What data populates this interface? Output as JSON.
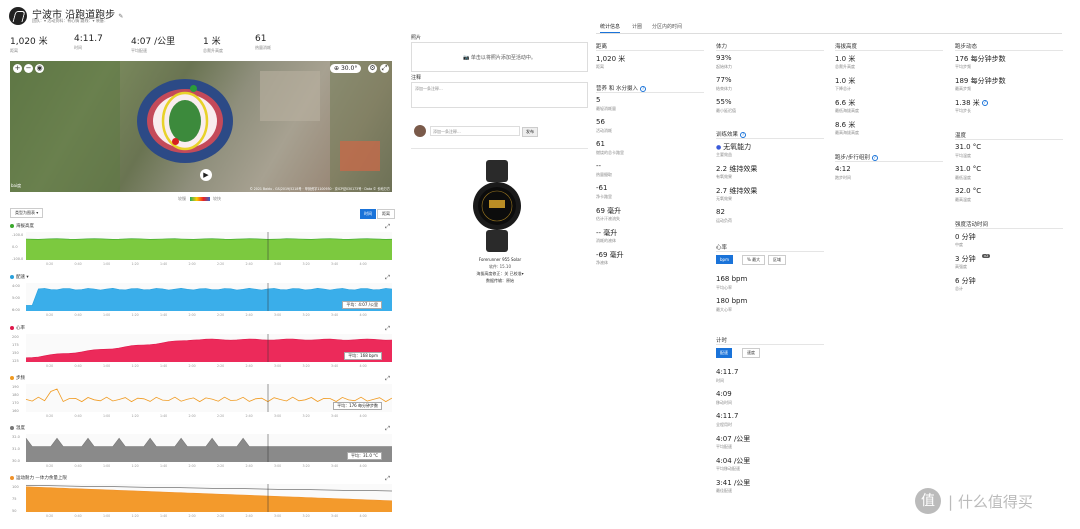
{
  "header": {
    "title": "宁波市 沿跑道跑步",
    "subline": "团队：▾   活动资料：有心情   路线：▾   装备："
  },
  "summary": [
    {
      "value": "1,020 米",
      "label": "距离"
    },
    {
      "value": "4:11.7",
      "label": "时间"
    },
    {
      "value": "4:07 /公里",
      "label": "平均配速"
    },
    {
      "value": "1 米",
      "label": "总爬升高度"
    },
    {
      "value": "61",
      "label": "热量消耗"
    }
  ],
  "map": {
    "zoom_label": "30.0°",
    "credits": "© 2021 Baidu - GS(2019)5218号 · 甲测资字1100930 · 京ICP证030173号 · Data © 长地万方",
    "legend_left": "较慢",
    "legend_right": "较快"
  },
  "charts_toolbar": {
    "select": "类型为图表 ▾",
    "btn_time": "时间",
    "btn_distance": "距离"
  },
  "charts": [
    {
      "key": "elev",
      "title": "海拔高度",
      "color": "#39a82c",
      "fill": "#7cc93f",
      "ticks": [
        "-100.0",
        "0.0",
        "-100.0"
      ],
      "avg": ""
    },
    {
      "key": "pace",
      "title": "配速 ▾",
      "color": "#2aa1dc",
      "fill": "#3aaeea",
      "ticks": [
        "4:00",
        "5:00",
        "6:00"
      ],
      "avg": "平均：4:07 /公里"
    },
    {
      "key": "hr",
      "title": "心率",
      "color": "#e0184b",
      "fill": "#ec2a5a",
      "ticks": [
        "200",
        "175",
        "150",
        "125"
      ],
      "avg": "平均：168 bpm"
    },
    {
      "key": "cad",
      "title": "步频",
      "color": "#f09a20",
      "fill": "none",
      "ticks": [
        "190",
        "180",
        "170",
        "160"
      ],
      "avg": "平均：176 每分钟步数"
    },
    {
      "key": "temp",
      "title": "温度",
      "color": "#777777",
      "fill": "#8a8a8a",
      "ticks": [
        "32.0",
        "31.0",
        "30.0"
      ],
      "avg": "平均：31.0 °C"
    },
    {
      "key": "stam",
      "title": "运动耐力   —体力余量上限",
      "color": "#f0922a",
      "fill": "#f39a2c",
      "ticks": [
        "100",
        "75",
        "50"
      ],
      "avg": ""
    }
  ],
  "xaxis": [
    "0:20",
    "0:40",
    "1:00",
    "1:20",
    "1:40",
    "2:00",
    "2:20",
    "2:40",
    "3:00",
    "3:20",
    "3:40",
    "4:00"
  ],
  "photos": {
    "title": "照片",
    "add_text": "单击以将照片添加至活动中。"
  },
  "notes": {
    "title": "注释",
    "placeholder": "添加一条注释...",
    "comment_placeholder": "添加一条注释...",
    "submit": "发布"
  },
  "device": {
    "name": "Forerunner 955 Solar",
    "version": "软件: 15.10",
    "row1": "海拔高度修正：关   已校准▾",
    "row2": "数据传输：原始"
  },
  "stats_tabs": [
    "统计信息",
    "计圈",
    "分区内的时间"
  ],
  "stats": {
    "distance": {
      "head": "距离",
      "items": [
        {
          "v": "1,020 米",
          "l": "距离"
        }
      ]
    },
    "nutrition": {
      "head": "营养 和 水分摄入",
      "items": [
        {
          "v": "5",
          "l": "最轻消耗量"
        },
        {
          "v": "56",
          "l": "活动消耗"
        },
        {
          "v": "61",
          "l": "燃烧的总卡路里"
        },
        {
          "v": "--",
          "l": "热量摄取"
        },
        {
          "v": "-61",
          "l": "净卡路里"
        },
        {
          "v": "69 毫升",
          "l": "估计汗液流失"
        },
        {
          "v": "-- 毫升",
          "l": "消耗的液体"
        },
        {
          "v": "-69 毫升",
          "l": "净液体"
        }
      ]
    },
    "body": {
      "head": "体力",
      "items": [
        {
          "v": "93%",
          "l": "起始体力"
        },
        {
          "v": "77%",
          "l": "结束体力"
        },
        {
          "v": "55%",
          "l": "最小延迟值"
        }
      ]
    },
    "training": {
      "head": "训练效果",
      "items": [
        {
          "v": "无氧能力",
          "l": "主要效益"
        },
        {
          "v": "2.2 维持效果",
          "l": "有氧效果"
        },
        {
          "v": "2.7 维持效果",
          "l": "无氧效果"
        },
        {
          "v": "82",
          "l": "运动负荷"
        }
      ]
    },
    "hr": {
      "head": "心率",
      "buttons": [
        "bpm",
        "% 最大",
        "区域"
      ],
      "items": [
        {
          "v": "168 bpm",
          "l": "平均心率"
        },
        {
          "v": "180 bpm",
          "l": "最大心率"
        }
      ]
    },
    "timing": {
      "head": "计时",
      "buttons": [
        "配速",
        "速度"
      ],
      "items": [
        {
          "v": "4:11.7",
          "l": "时间"
        },
        {
          "v": "4:09",
          "l": "移动时间"
        },
        {
          "v": "4:11.7",
          "l": "全程用时"
        },
        {
          "v": "4:07 /公里",
          "l": "平均配速"
        },
        {
          "v": "4:04 /公里",
          "l": "平均移动配速"
        },
        {
          "v": "3:41 /公里",
          "l": "最佳配速"
        }
      ]
    },
    "elevation": {
      "head": "海拔高度",
      "items": [
        {
          "v": "1.0 米",
          "l": "总爬升高度"
        },
        {
          "v": "1.0 米",
          "l": "下降总计"
        },
        {
          "v": "6.6 米",
          "l": "最低海拔高度"
        },
        {
          "v": "8.6 米",
          "l": "最高海拔高度"
        }
      ]
    },
    "steps": {
      "head": "跑步/步行组别",
      "items": [
        {
          "v": "4:12",
          "l": "跑步时间"
        }
      ]
    },
    "dynamics": {
      "head": "跑步动态",
      "items": [
        {
          "v": "176 每分钟步数",
          "l": "平均步频"
        },
        {
          "v": "189 每分钟步数",
          "l": "最高步频"
        },
        {
          "v": "1.38 米",
          "l": "平均步长"
        }
      ]
    },
    "temperature": {
      "head": "温度",
      "items": [
        {
          "v": "31.0 °C",
          "l": "平均温度"
        },
        {
          "v": "31.0 °C",
          "l": "最低温度"
        },
        {
          "v": "32.0 °C",
          "l": "最高温度"
        }
      ]
    },
    "intensity": {
      "head": "强度活动时间",
      "items": [
        {
          "v": "0 分钟",
          "l": "中度"
        },
        {
          "v": "3 分钟",
          "l": "高强度",
          "badge": "x2"
        },
        {
          "v": "6 分钟",
          "l": "总计"
        }
      ]
    }
  },
  "watermark": "值 | 什么值得买"
}
